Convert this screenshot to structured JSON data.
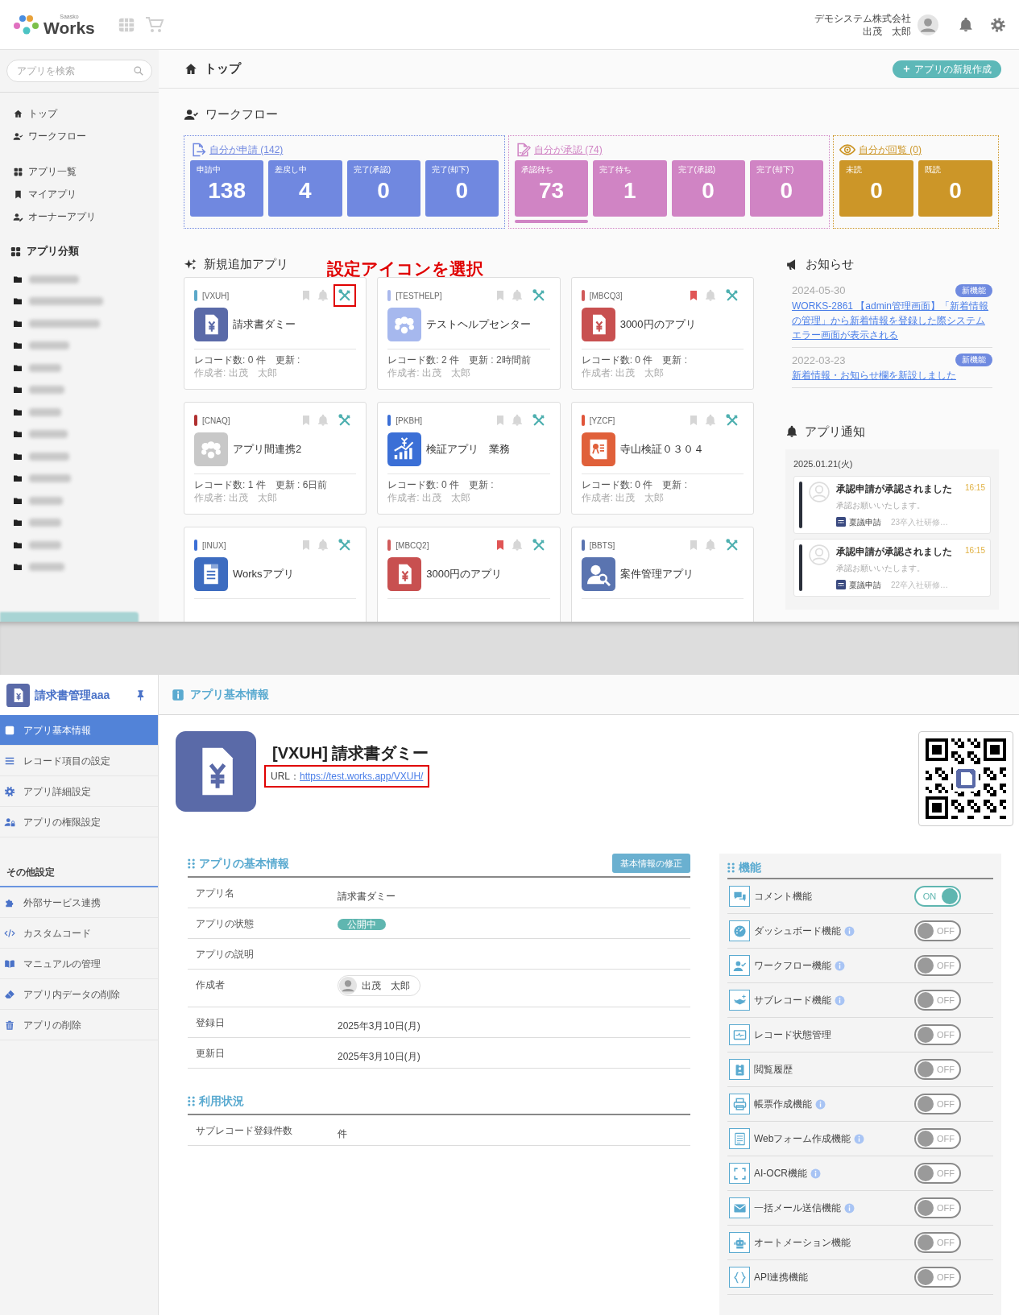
{
  "header": {
    "logo_small": "Saasko",
    "logo_text": "Works",
    "company": "デモシステム株式会社",
    "user": "出茂　太郎"
  },
  "sidebar": {
    "search_placeholder": "アプリを検索",
    "nav_groups": [
      [
        {
          "label": "トップ"
        },
        {
          "label": "ワークフロー"
        }
      ],
      [
        {
          "label": "アプリ一覧"
        },
        {
          "label": "マイアプリ"
        },
        {
          "label": "オーナーアプリ"
        }
      ]
    ],
    "category_heading": "アプリ分類",
    "category_folders": [
      {
        "kind": "blurred"
      },
      {
        "kind": "blurred"
      },
      {
        "kind": "blurred"
      },
      {
        "kind": "blurred"
      },
      {
        "kind": "blurred"
      },
      {
        "kind": "blurred"
      },
      {
        "kind": "blurred"
      },
      {
        "kind": "blurred"
      },
      {
        "kind": "blurred"
      },
      {
        "kind": "blurred"
      },
      {
        "kind": "blurred"
      },
      {
        "kind": "blurred"
      },
      {
        "kind": "blurred"
      },
      {
        "kind": "blurred"
      }
    ],
    "status_link": {
      "kind": "blurred"
    }
  },
  "page_title": "トップ",
  "new_app_button": "アプリの新規作成",
  "workflow": {
    "heading": "ワークフロー",
    "groups": [
      {
        "kind": "apply",
        "link": "自分が申請 (142)",
        "color": "#7088e0",
        "tiles": [
          {
            "label": "申請中",
            "value": "138",
            "selected": false
          },
          {
            "label": "差戻し中",
            "value": "4",
            "selected": false
          },
          {
            "label": "完了(承認)",
            "value": "0",
            "selected": false
          },
          {
            "label": "完了(却下)",
            "value": "0",
            "selected": false
          }
        ]
      },
      {
        "kind": "approve",
        "link": "自分が承認 (74)",
        "color": "#d084c4",
        "tiles": [
          {
            "label": "承認待ち",
            "value": "73",
            "selected": true
          },
          {
            "label": "完了待ち",
            "value": "1",
            "selected": false
          },
          {
            "label": "完了(承認)",
            "value": "0",
            "selected": false
          },
          {
            "label": "完了(却下)",
            "value": "0",
            "selected": false
          }
        ]
      },
      {
        "kind": "circulate",
        "link": "自分が回覧 (0)",
        "color": "#cc9628",
        "tiles": [
          {
            "label": "未読",
            "value": "0",
            "selected": false
          },
          {
            "label": "既読",
            "value": "0",
            "selected": false
          }
        ]
      }
    ]
  },
  "new_apps": {
    "heading": "新規追加アプリ",
    "annotation": "設定アイコンを選択",
    "cards": [
      {
        "code": "[VXUH]",
        "color": "#5ba8c9",
        "name": "請求書ダミー",
        "stats": "レコード数: 0 件　更新 :",
        "author": "作成者: 出茂　太郎",
        "bookmarked": false,
        "highlighted": true
      },
      {
        "code": "[TESTHELP]",
        "color": "#a9b8ec",
        "name": "テストヘルプセンター",
        "stats": "レコード数: 2 件　更新 : 2時間前",
        "author": "作成者: 出茂　太郎",
        "bookmarked": false,
        "highlighted": false
      },
      {
        "code": "[MBCQ3]",
        "color": "#d05a5a",
        "name": "3000円のアプリ",
        "stats": "レコード数: 0 件　更新 :",
        "author": "作成者: 出茂　太郎",
        "bookmarked": true,
        "highlighted": false
      },
      {
        "code": "[CNAQ]",
        "color": "#b03030",
        "name": "アプリ間連携2",
        "stats": "レコード数: 1 件　更新 : 6日前",
        "author": "作成者: 出茂　太郎",
        "bookmarked": false,
        "highlighted": false
      },
      {
        "code": "[PKBH]",
        "color": "#3b6fd6",
        "name": "検証アプリ　業務",
        "stats": "レコード数: 0 件　更新 :",
        "author": "作成者: 出茂　太郎",
        "bookmarked": false,
        "highlighted": false
      },
      {
        "code": "[YZCF]",
        "color": "#e0553a",
        "name": "寺山検証０３０４",
        "stats": "レコード数: 0 件　更新 :",
        "author": "作成者: 出茂　太郎",
        "bookmarked": false,
        "highlighted": false
      },
      {
        "code": "[INUX]",
        "color": "#3b6fd6",
        "name": "Worksアプリ",
        "bookmarked": false,
        "highlighted": false
      },
      {
        "code": "[MBCQ2]",
        "color": "#d05a5a",
        "name": "3000円のアプリ",
        "bookmarked": true,
        "highlighted": false
      },
      {
        "code": "[BBTS]",
        "color": "#5a74b0",
        "name": "案件管理アプリ",
        "bookmarked": false,
        "highlighted": false
      }
    ]
  },
  "news": {
    "heading": "お知らせ",
    "items": [
      {
        "date": "2024-05-30",
        "badge": "新機能",
        "link": "WORKS-2861 【admin管理画面】「新着情報の管理」から新着情報を登録した際システムエラー画面が表示される"
      },
      {
        "date": "2022-03-23",
        "badge": "新機能",
        "link": "新着情報・お知らせ欄を新設しました"
      }
    ]
  },
  "app_notifications": {
    "heading": "アプリ通知",
    "date": "2025.01.21(火)",
    "items": [
      {
        "title": "承認申請が承認されました",
        "time": "16:15",
        "message": "承認お願いいたします。",
        "app": "稟議申請",
        "record": "23卒入社研修…"
      },
      {
        "title": "承認申請が承認されました",
        "time": "16:15",
        "message": "承認お願いいたします。",
        "app": "稟議申請",
        "record": "22卒入社研修…"
      }
    ]
  },
  "settings_sidebar": {
    "app_name": "請求書管理aaa",
    "menu": [
      {
        "label": "アプリ基本情報",
        "selected": true
      },
      {
        "label": "レコード項目の設定",
        "selected": false
      },
      {
        "label": "アプリ詳細設定",
        "selected": false
      },
      {
        "label": "アプリの権限設定",
        "selected": false
      }
    ],
    "other_heading": "その他設定",
    "other_menu": [
      {
        "label": "外部サービス連携",
        "selected": false
      },
      {
        "label": "カスタムコード",
        "selected": false
      },
      {
        "label": "マニュアルの管理",
        "selected": false
      },
      {
        "label": "アプリ内データの削除",
        "selected": false
      },
      {
        "label": "アプリの削除",
        "selected": false
      }
    ]
  },
  "detail": {
    "heading": "アプリ基本情報",
    "title": "[VXUH] 請求書ダミー",
    "url_label": "URL：",
    "url": "https://test.works.app/VXUH/",
    "url_highlighted": true,
    "basic_heading": "アプリの基本情報",
    "edit_button": "基本情報の修正",
    "rows": [
      {
        "kind": "text",
        "label": "アプリ名",
        "value": "請求書ダミー"
      },
      {
        "kind": "badge",
        "label": "アプリの状態",
        "value": "公開中"
      },
      {
        "kind": "text",
        "label": "アプリの説明"
      },
      {
        "kind": "user",
        "label": "作成者",
        "value": "出茂　太郎"
      },
      {
        "kind": "text",
        "label": "登録日",
        "value": "2025年3月10日(月)"
      },
      {
        "kind": "text",
        "label": "更新日",
        "value": "2025年3月10日(月)"
      }
    ],
    "usage_heading": "利用状況",
    "usage_rows": [
      {
        "kind": "text",
        "label": "サブレコード登録件数",
        "value": "件"
      }
    ],
    "features_heading": "機能",
    "features": [
      {
        "label": "コメント機能",
        "info": false,
        "on": true,
        "state": "ON"
      },
      {
        "label": "ダッシュボード機能",
        "info": true,
        "on": false,
        "state": "OFF"
      },
      {
        "label": "ワークフロー機能",
        "info": true,
        "on": false,
        "state": "OFF"
      },
      {
        "label": "サブレコード機能",
        "info": true,
        "on": false,
        "state": "OFF"
      },
      {
        "label": "レコード状態管理",
        "info": false,
        "on": false,
        "state": "OFF"
      },
      {
        "label": "閲覧履歴",
        "info": false,
        "on": false,
        "state": "OFF"
      },
      {
        "label": "帳票作成機能",
        "info": true,
        "on": false,
        "state": "OFF"
      },
      {
        "label": "Webフォーム作成機能",
        "info": true,
        "on": false,
        "state": "OFF"
      },
      {
        "label": "AI-OCR機能",
        "info": true,
        "on": false,
        "state": "OFF"
      },
      {
        "label": "一括メール送信機能",
        "info": true,
        "on": false,
        "state": "OFF"
      },
      {
        "label": "オートメーション機能",
        "info": false,
        "on": false,
        "state": "OFF"
      },
      {
        "label": "API連携機能",
        "info": false,
        "on": false,
        "state": "OFF"
      }
    ]
  }
}
